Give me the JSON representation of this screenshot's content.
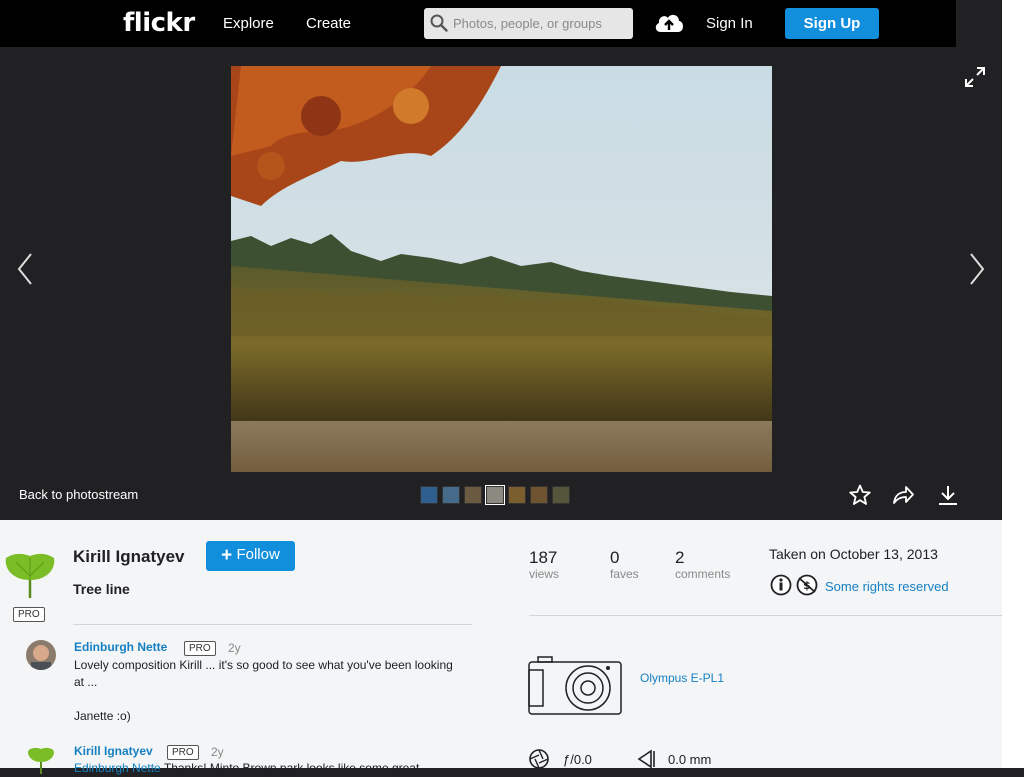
{
  "header": {
    "logo": "flickr",
    "nav": [
      "Explore",
      "Create"
    ],
    "search_placeholder": "Photos, people, or groups",
    "signin_label": "Sign In",
    "signup_label": "Sign Up"
  },
  "viewer": {
    "back_label": "Back to photostream",
    "thumbnail_count": 7,
    "active_thumbnail_index": 3
  },
  "owner": {
    "name": "Kirill Ignatyev",
    "pro_label": "PRO",
    "follow_label": "Follow"
  },
  "photo": {
    "title": "Tree line",
    "taken": "Taken on October 13, 2013",
    "license": "Some rights reserved"
  },
  "stats": [
    {
      "value": "187",
      "label": "views"
    },
    {
      "value": "0",
      "label": "faves"
    },
    {
      "value": "2",
      "label": "comments"
    }
  ],
  "comments": [
    {
      "author": "Edinburgh Nette",
      "pro": "PRO",
      "time": "2y",
      "text": "Lovely composition Kirill ... it's so good to see what you've been looking at ...",
      "signoff": "Janette :o)"
    },
    {
      "author": "Kirill Ignatyev",
      "pro": "PRO",
      "time": "2y",
      "mention": "Edinburgh Nette",
      "text": "Thanks! Minto Brown park looks like some great"
    }
  ],
  "camera": {
    "model": "Olympus E-PL1"
  },
  "exif": {
    "aperture": "ƒ/0.0",
    "focal_length": "0.0 mm"
  },
  "colors": {
    "accent": "#128fdc",
    "link": "#1780c2",
    "viewer_bg": "#212124",
    "info_bg": "#f3f5f6"
  }
}
